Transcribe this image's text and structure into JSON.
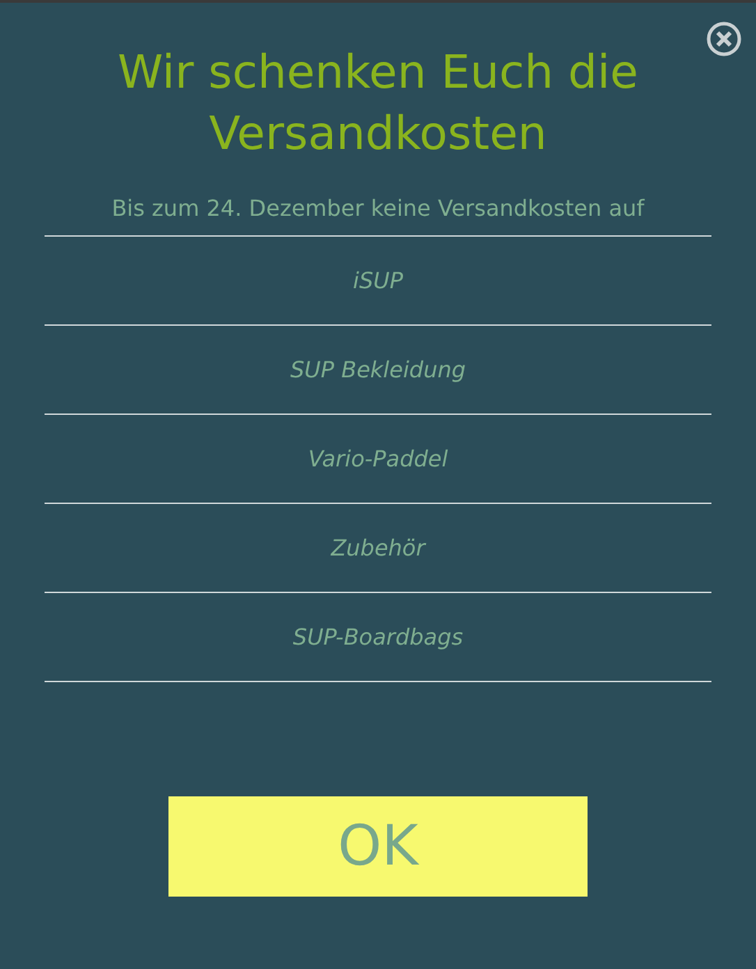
{
  "dialog": {
    "title": "Wir schenken Euch die Versandkosten",
    "subtitle": "Bis zum 24. Dezember keine Versandkosten auf",
    "items": [
      {
        "label": "iSUP"
      },
      {
        "label": "SUP Bekleidung"
      },
      {
        "label": "Vario-Paddel"
      },
      {
        "label": "Zubehör"
      },
      {
        "label": "SUP-Boardbags"
      }
    ],
    "button": "OK"
  }
}
